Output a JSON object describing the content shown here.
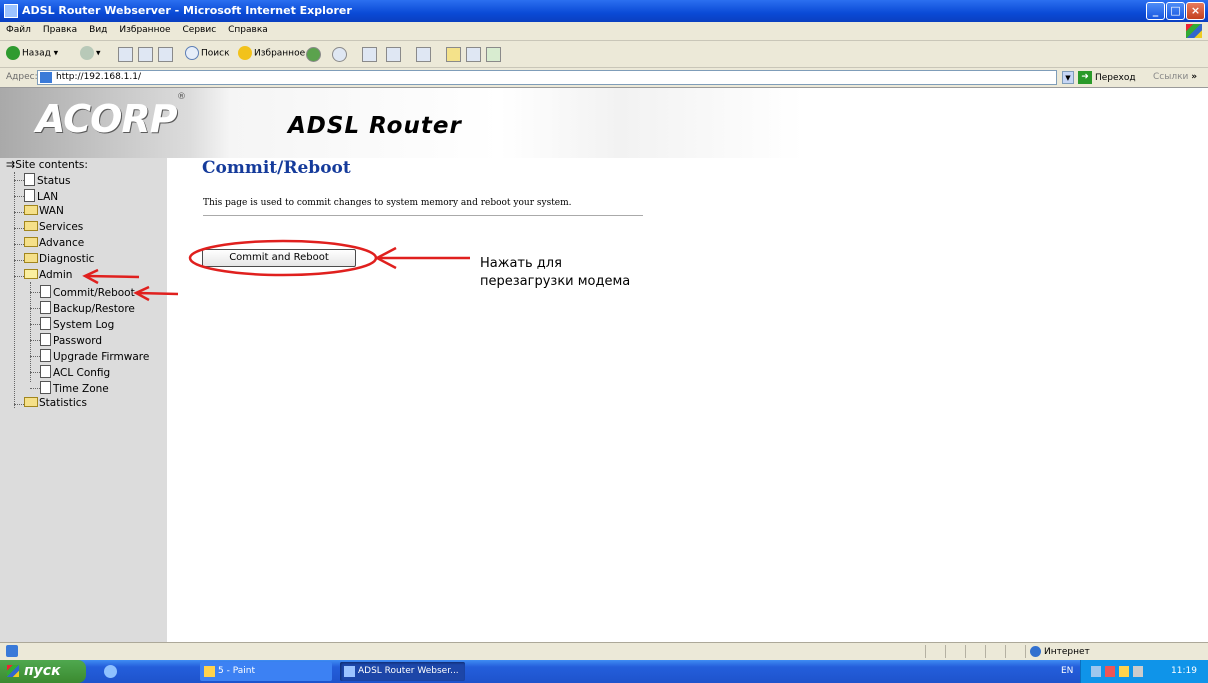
{
  "window": {
    "title": "ADSL Router Webserver - Microsoft Internet Explorer",
    "minimize": "_",
    "maximize": "□",
    "close": "×"
  },
  "menu": [
    "Файл",
    "Правка",
    "Вид",
    "Избранное",
    "Сервис",
    "Справка"
  ],
  "toolbar": {
    "back": "Назад",
    "search": "Поиск",
    "favorites": "Избранное"
  },
  "address": {
    "label": "Адрес:",
    "url": "http://192.168.1.1/",
    "go": "Переход",
    "links": "Ссылки"
  },
  "banner": {
    "logo": "ACORP",
    "registered": "®",
    "title": "ADSL Router"
  },
  "sidebar": {
    "header": "Site contents:",
    "items": [
      {
        "label": "Status",
        "type": "page"
      },
      {
        "label": "LAN",
        "type": "page"
      },
      {
        "label": "WAN",
        "type": "folder"
      },
      {
        "label": "Services",
        "type": "folder"
      },
      {
        "label": "Advance",
        "type": "folder"
      },
      {
        "label": "Diagnostic",
        "type": "folder"
      },
      {
        "label": "Admin",
        "type": "folder-open"
      },
      {
        "label": "Commit/Reboot",
        "type": "page"
      },
      {
        "label": "Backup/Restore",
        "type": "page"
      },
      {
        "label": "System Log",
        "type": "page"
      },
      {
        "label": "Password",
        "type": "page"
      },
      {
        "label": "Upgrade Firmware",
        "type": "page"
      },
      {
        "label": "ACL Config",
        "type": "page"
      },
      {
        "label": "Time Zone",
        "type": "page"
      },
      {
        "label": "Statistics",
        "type": "folder"
      }
    ]
  },
  "main": {
    "title": "Commit/Reboot",
    "description": "This page is used to commit changes to system memory and reboot your system.",
    "button_label": "Commit and Reboot"
  },
  "annotation": {
    "line1": "Нажать для",
    "line2": "перезагрузки модема",
    "color": "#e0201e"
  },
  "statusbar": {
    "zone": "Интернет"
  },
  "taskbar": {
    "start": "пуск",
    "tasks": [
      "5 - Paint",
      "ADSL Router Webser..."
    ],
    "lang": "EN",
    "clock": "11:19"
  }
}
